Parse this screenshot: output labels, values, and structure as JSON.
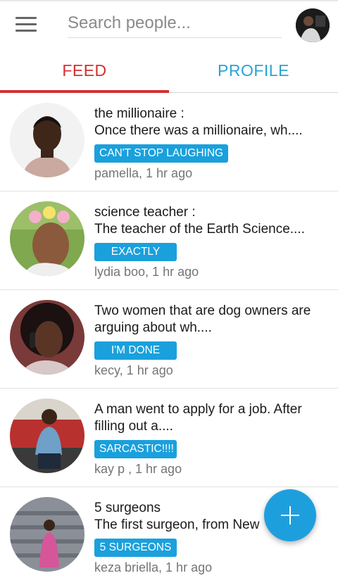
{
  "header": {
    "search_placeholder": "Search people..."
  },
  "tabs": [
    {
      "label": "FEED",
      "active": true,
      "color": "#d32f2f"
    },
    {
      "label": "PROFILE",
      "active": false,
      "color": "#29a3d6"
    }
  ],
  "feed": [
    {
      "title": "the millionaire :",
      "excerpt": "Once there was a millionaire, wh....",
      "tag": "CAN'T STOP LAUGHING",
      "meta": "pamella, 1 hr ago"
    },
    {
      "title": "science teacher :",
      "excerpt": "The teacher of the Earth Science....",
      "tag": "EXACTLY",
      "meta": "lydia boo, 1 hr ago"
    },
    {
      "title": "Two women that are dog owners are",
      "excerpt": "arguing about wh....",
      "tag": "I'M DONE",
      "meta": "kecy, 1 hr ago"
    },
    {
      "title": "A man went to apply for a job. After",
      "excerpt": "filling out a....",
      "tag": "SARCASTIC!!!!",
      "meta": "kay p , 1 hr ago"
    },
    {
      "title": "5 surgeons",
      "excerpt": "The first surgeon, from New",
      "tag": "5 SURGEONS",
      "meta": "keza briella, 1 hr ago"
    }
  ],
  "colors": {
    "accent": "#1aa0dc",
    "active_tab": "#d32f2f",
    "fab": "#1e9fdd"
  },
  "icons": {
    "menu": "hamburger-menu-icon",
    "fab": "plus-icon"
  }
}
